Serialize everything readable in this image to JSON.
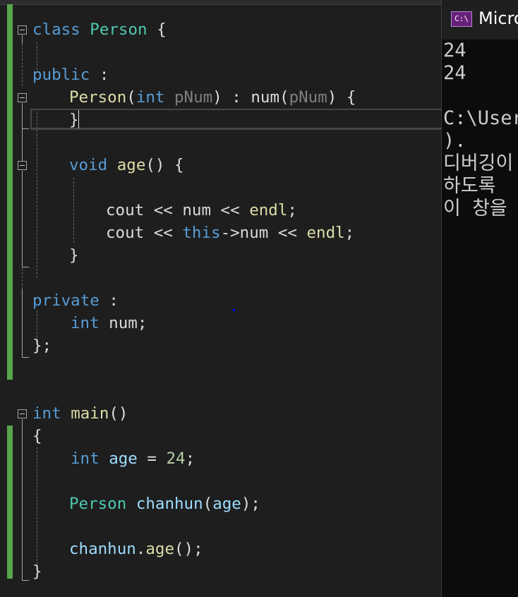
{
  "editor": {
    "lines": {
      "class_kw": "class",
      "class_name": "Person",
      "class_open": " {",
      "public_kw": "public",
      "public_colon": " :",
      "ctor_name": "Person",
      "ctor_open": "(",
      "ctor_int": "int",
      "ctor_param": "pNum",
      "ctor_close": ") : ",
      "ctor_init": "num",
      "ctor_init_open": "(",
      "ctor_init_arg": "pNum",
      "ctor_init_close": ") {",
      "ctor_end": "}",
      "void_kw": "void",
      "age_fn": "age",
      "age_sig": "() {",
      "cout1": "cout",
      "op1": " << ",
      "num1": "num",
      "op2": " << ",
      "endl1": "endl",
      "semi1": ";",
      "cout2": "cout",
      "op3": " << ",
      "this_kw": "this",
      "arrow": "->",
      "num2": "num",
      "op4": " << ",
      "endl2": "endl",
      "semi2": ";",
      "age_end": "}",
      "private_kw": "private",
      "private_colon": " :",
      "int_kw": "int",
      "num_decl": " num;",
      "class_end": "};",
      "main_int": "int",
      "main_fn": "main",
      "main_parens": "()",
      "main_open": "{",
      "age_int": "int",
      "age_var": "age",
      "age_assign": " = ",
      "age_val": "24",
      "age_semi": ";",
      "person_type": "Person",
      "obj_name": "chanhun",
      "obj_paren": "(",
      "obj_arg": "age",
      "obj_end": ");",
      "call_obj": "chanhun",
      "call_dot": ".",
      "call_fn": "age",
      "call_end": "();",
      "main_close": "}"
    }
  },
  "console": {
    "icon_text": "C:\\",
    "title": "Micro",
    "output": [
      "24",
      "24",
      "",
      "C:\\Users",
      ").",
      "디버깅이",
      "하도록",
      "이 창을"
    ]
  },
  "colors": {
    "keyword": "#569cd6",
    "type": "#4ec9b0",
    "function": "#dcdcaa",
    "parameter": "#7f7f7f",
    "variable": "#9cdcfe",
    "number": "#b5cea8",
    "change_bar": "#57a64a"
  }
}
